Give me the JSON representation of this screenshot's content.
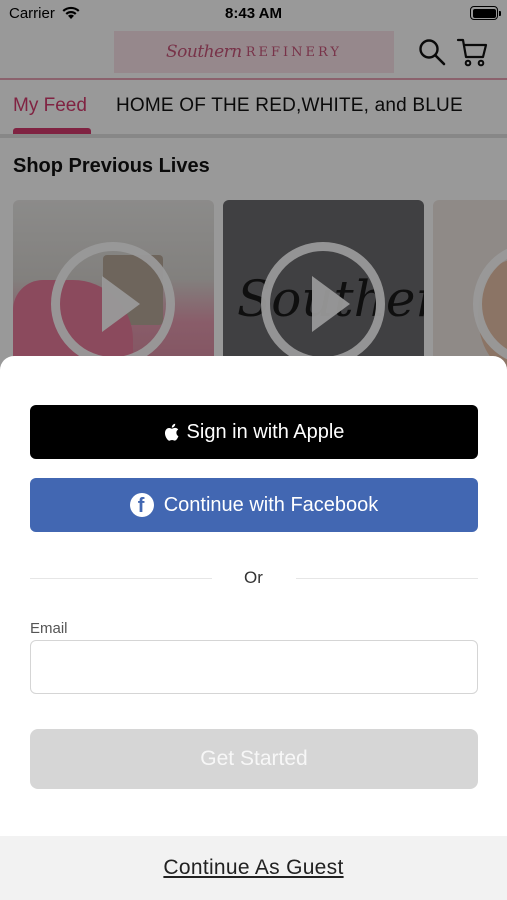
{
  "status_bar": {
    "carrier": "Carrier",
    "time": "8:43 AM"
  },
  "header": {
    "logo_script": "Southern",
    "logo_caps": "REFINERY",
    "icons": [
      "search-icon",
      "cart-icon"
    ]
  },
  "tabs": [
    {
      "label": "My Feed",
      "active": true
    },
    {
      "label": "HOME OF THE RED,WHITE, and BLUE",
      "active": false
    }
  ],
  "section": {
    "title": "Shop Previous Lives"
  },
  "videos": [
    {
      "thumb": "pink-outfit-on-chair"
    },
    {
      "thumb": "southern-script-logo",
      "text": "Southern"
    },
    {
      "thumb": "partial-thumbnail"
    }
  ],
  "login": {
    "apple_label": "Sign in with Apple",
    "facebook_label": "Continue with Facebook",
    "or_label": "Or",
    "email_label": "Email",
    "email_value": "",
    "get_started_label": "Get Started",
    "guest_label": "Continue As Guest"
  },
  "colors": {
    "accent": "#d63b6e",
    "facebook": "#4267b2",
    "apple": "#000000",
    "disabled_button": "#d6d6d6"
  }
}
